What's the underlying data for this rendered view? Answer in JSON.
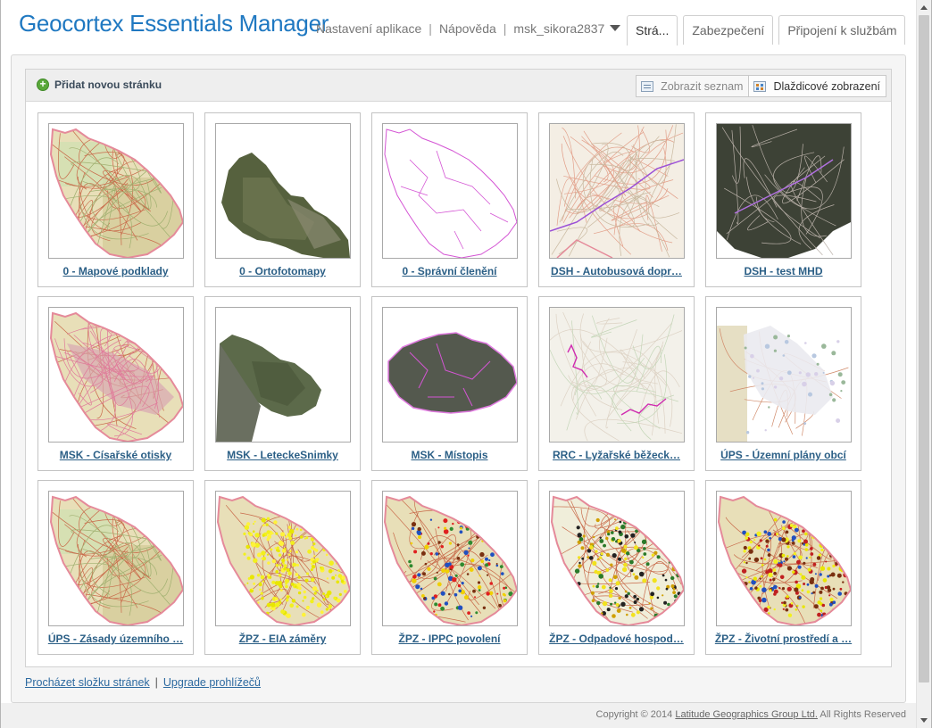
{
  "app": {
    "title": "Geocortex Essentials Manager"
  },
  "topnav": {
    "settings": "Nastavení aplikace",
    "help": "Nápověda",
    "user": "msk_sikora2837"
  },
  "tabs": [
    {
      "label": "Strá...",
      "active": true
    },
    {
      "label": "Zabezpečení",
      "active": false
    },
    {
      "label": "Připojení k službám",
      "active": false
    }
  ],
  "toolbar": {
    "add_page": "Přidat novou stránku",
    "list_view": "Zobrazit seznam",
    "tile_view": "Dlaždicové zobrazení"
  },
  "pages": [
    {
      "title": "0 - Mapové podklady",
      "thumb": "topo"
    },
    {
      "title": "0 - Ortofotomapy",
      "thumb": "ortho"
    },
    {
      "title": "0 - Správní členění",
      "thumb": "admin"
    },
    {
      "title": "DSH - Autobusová dopr…",
      "thumb": "bus"
    },
    {
      "title": "DSH - test MHD",
      "thumb": "dark"
    },
    {
      "title": "MSK - Císařské otisky",
      "thumb": "cadastre"
    },
    {
      "title": "MSK - LeteckeSnimky",
      "thumb": "aerial"
    },
    {
      "title": "MSK - Místopis",
      "thumb": "czech"
    },
    {
      "title": "RRC - Lyžařské běžeck…",
      "thumb": "ski"
    },
    {
      "title": "ÚPS - Územní plány obcí",
      "thumb": "plans"
    },
    {
      "title": "ÚPS - Zásady územního …",
      "thumb": "topo"
    },
    {
      "title": "ŽPZ - EIA záměry",
      "thumb": "yellow"
    },
    {
      "title": "ŽPZ - IPPC povolení",
      "thumb": "dots"
    },
    {
      "title": "ŽPZ - Odpadové hospod…",
      "thumb": "waste"
    },
    {
      "title": "ŽPZ - Životní prostředí a …",
      "thumb": "env"
    }
  ],
  "footer": {
    "browse": "Procházet složku stránek",
    "upgrade": "Upgrade prohlížečů",
    "copyright_prefix": "Copyright © 2014",
    "company": "Latitude Geographics Group Ltd.",
    "rights": "All Rights Reserved"
  }
}
